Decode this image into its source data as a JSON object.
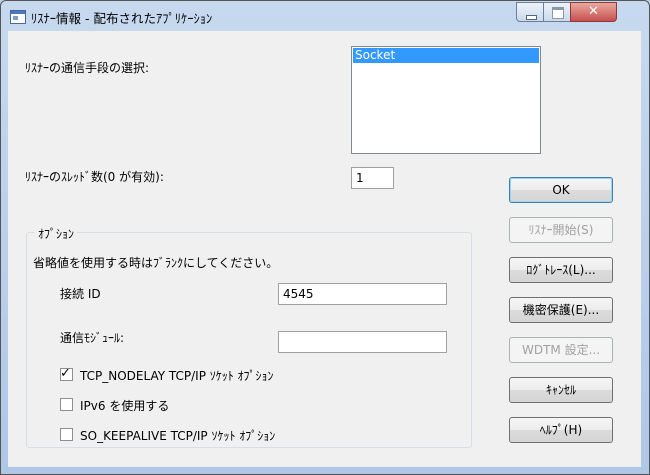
{
  "window": {
    "title": "ﾘｽﾅｰ情報 - 配布されたｱﾌﾟﾘｹｰｼｮﾝ",
    "close_glyph": "✕"
  },
  "comm_method": {
    "label": "ﾘｽﾅｰの通信手段の選択:",
    "items": [
      "Socket"
    ],
    "selected": "Socket"
  },
  "threads": {
    "label": "ﾘｽﾅｰのｽﾚｯﾄﾞ数(0 が有効):",
    "value": "1"
  },
  "options": {
    "title": "ｵﾌﾟｼｮﾝ",
    "hint": "省略値を使用する時はﾌﾞﾗﾝｸにしてください。",
    "connection_id": {
      "label": "接続 ID",
      "value": "4545"
    },
    "comm_module": {
      "label": "通信ﾓｼﾞｭｰﾙ:",
      "value": ""
    },
    "checkboxes": [
      {
        "label": "TCP_NODELAY TCP/IP ｿｹｯﾄ ｵﾌﾟｼｮﾝ",
        "checked": true
      },
      {
        "label": "IPv6 を使用する",
        "checked": false
      },
      {
        "label": "SO_KEEPALIVE TCP/IP ｿｹｯﾄ ｵﾌﾟｼｮﾝ",
        "checked": false
      }
    ],
    "check_glyph": "✓"
  },
  "buttons": {
    "ok": "OK",
    "start_listener": "ﾘｽﾅｰ開始(S)",
    "log_trace": "ﾛｸﾞﾄﾚｰｽ(L)...",
    "secure": "機密保護(E)...",
    "wdtm": "WDTM 設定...",
    "cancel": "ｷｬﾝｾﾙ",
    "help": "ﾍﾙﾌﾟ(H)"
  }
}
